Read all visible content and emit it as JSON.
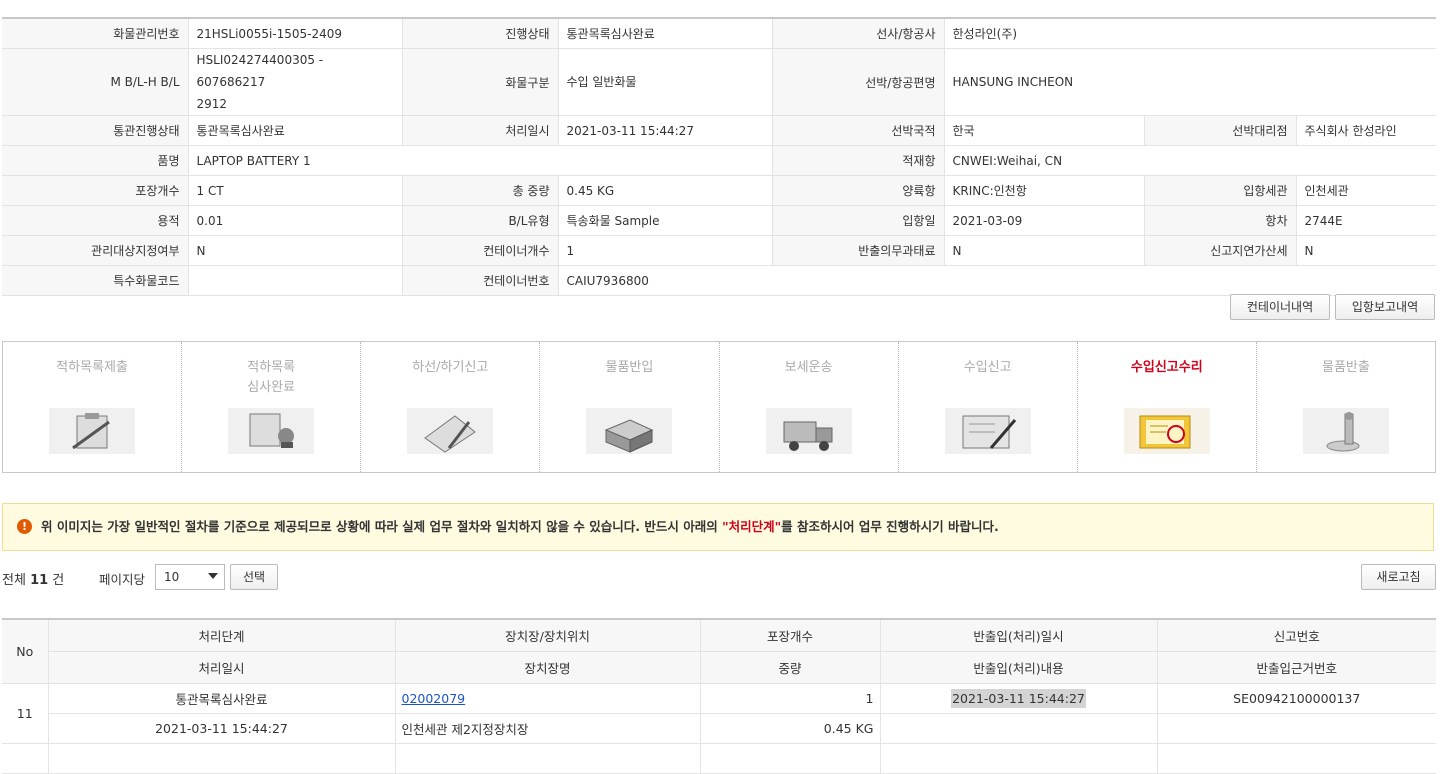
{
  "info": {
    "r1": {
      "k1": "화물관리번호",
      "v1": "21HSLi0055i-1505-2409",
      "k2": "진행상태",
      "v2": "통관목록심사완료",
      "k3": "선사/항공사",
      "v3": "한성라인(주)"
    },
    "r2": {
      "k1": "M B/L-H B/L",
      "v1a": "HSLI024274400305 - 607686217",
      "v1b": "2912",
      "k2": "화물구분",
      "v2": "수입 일반화물",
      "k3": "선박/항공편명",
      "v3": "HANSUNG INCHEON"
    },
    "r3": {
      "k1": "통관진행상태",
      "v1": "통관목록심사완료",
      "k2": "처리일시",
      "v2": "2021-03-11 15:44:27",
      "k3": "선박국적",
      "v3": "한국",
      "k4": "선박대리점",
      "v4": "주식회사 한성라인"
    },
    "r4": {
      "k1": "품명",
      "v1": "LAPTOP BATTERY 1",
      "k2": "적재항",
      "v2": "CNWEI:Weihai, CN"
    },
    "r5": {
      "k1": "포장개수",
      "v1": "1 CT",
      "k2": "총 중량",
      "v2": "0.45 KG",
      "k3": "양륙항",
      "v3": "KRINC:인천항",
      "k4": "입항세관",
      "v4": "인천세관"
    },
    "r6": {
      "k1": "용적",
      "v1": "0.01",
      "k2": "B/L유형",
      "v2": "특송화물 Sample",
      "k3": "입항일",
      "v3": "2021-03-09",
      "k4": "항차",
      "v4": "2744E"
    },
    "r7": {
      "k1": "관리대상지정여부",
      "v1": "N",
      "k2": "컨테이너개수",
      "v2": "1",
      "k3": "반출의무과태료",
      "v3": "N",
      "k4": "신고지연가산세",
      "v4": "N"
    },
    "r8": {
      "k1": "특수화물코드",
      "v1": "",
      "k2": "컨테이너번호",
      "v2": "CAIU7936800"
    }
  },
  "buttons": {
    "container": "컨테이너내역",
    "arrival": "입항보고내역",
    "select": "선택",
    "refresh": "새로고침"
  },
  "steps": [
    {
      "label": "적하목록제출",
      "icon": "clipboard-icon",
      "active": false
    },
    {
      "label": "적하목록\n심사완료",
      "icon": "stamp-icon",
      "active": false
    },
    {
      "label": "하선/하기신고",
      "icon": "notebook-pen-icon",
      "active": false
    },
    {
      "label": "물품반입",
      "icon": "boxes-icon",
      "active": false
    },
    {
      "label": "보세운송",
      "icon": "truck-icon",
      "active": false
    },
    {
      "label": "수입신고",
      "icon": "document-pen-icon",
      "active": false
    },
    {
      "label": "수입신고수리",
      "icon": "approved-document-icon",
      "active": true
    },
    {
      "label": "물품반출",
      "icon": "release-icon",
      "active": false
    }
  ],
  "notice": {
    "pre": "위 이미지는 가장 일반적인 절차를 기준으로 제공되므로 상황에 따라 실제 업무 절차와 일치하지 않을 수 있습니다. 반드시 아래의 ",
    "highlight": "\"처리단계\"",
    "post": "를 참조하시어 업무 진행하시기 바랍니다."
  },
  "toolbar": {
    "total_pre": "전체",
    "total_count": "11",
    "total_post": "건",
    "perpage_label": "페이지당",
    "perpage_value": "10"
  },
  "list": {
    "headers": {
      "no": "No",
      "h1a": "처리단계",
      "h1b": "처리일시",
      "h2a": "장치장/장치위치",
      "h2b": "장치장명",
      "h3a": "포장개수",
      "h3b": "중량",
      "h4a": "반출입(처리)일시",
      "h4b": "반출입(처리)내용",
      "h5a": "신고번호",
      "h5b": "반출입근거번호"
    },
    "rows": [
      {
        "no": "11",
        "step": "통관목록심사완료",
        "date": "2021-03-11 15:44:27",
        "loc": "02002079",
        "locname": "인천세관 제2지정장치장",
        "pkg": "1",
        "weight": "0.45 KG",
        "io_date": "2021-03-11 15:44:27",
        "io_content": "",
        "report_no": "SE00942100000137",
        "basis_no": ""
      }
    ]
  }
}
